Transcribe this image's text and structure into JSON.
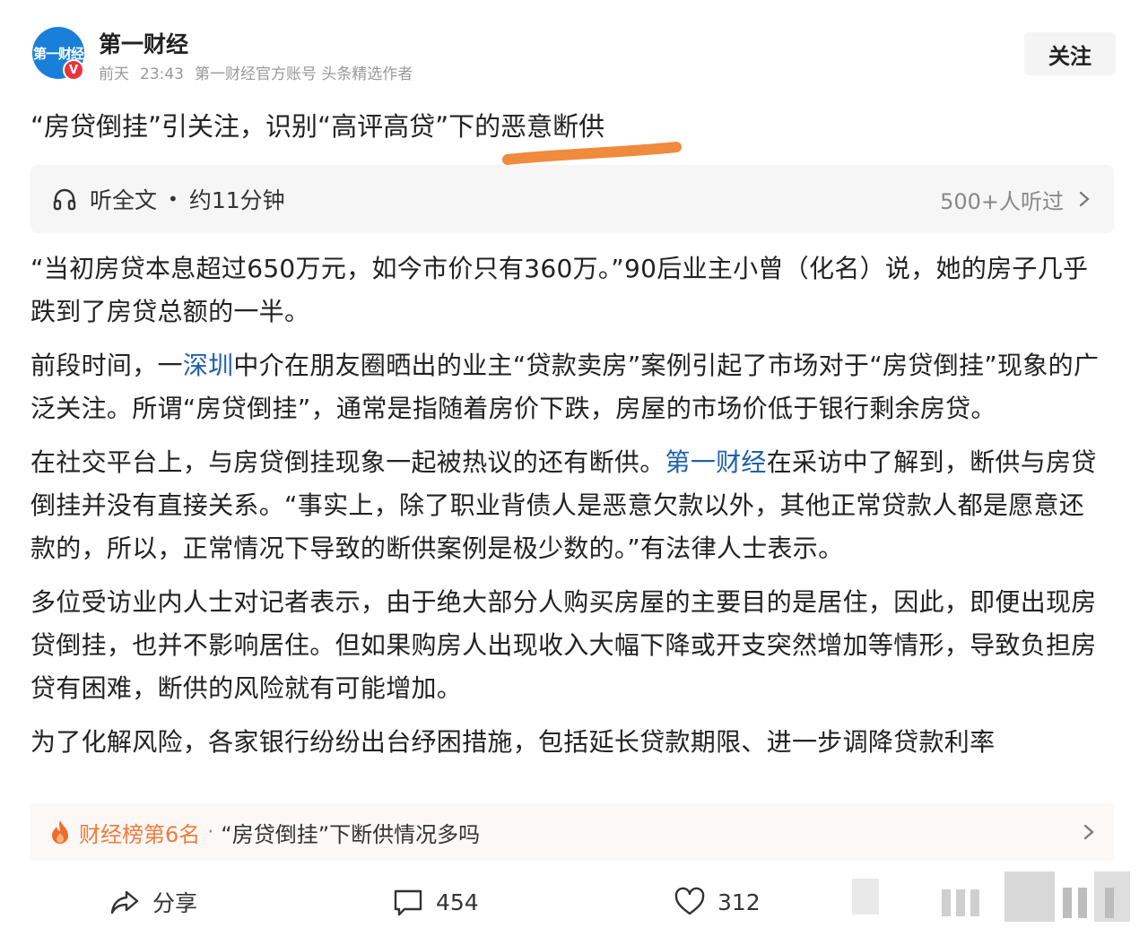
{
  "header": {
    "avatar_text": "第一财经",
    "verified_badge": "V",
    "author_name": "第一财经",
    "time_day": "前天",
    "time_clock": "23:43",
    "account_desc": "第一财经官方账号 头条精选作者",
    "follow_label": "关注"
  },
  "article": {
    "title": "“房贷倒挂”引关注，识别“高评高贷”下的恶意断供",
    "listen": {
      "label": "听全文",
      "dot": "•",
      "duration": "约11分钟",
      "count": "500+人听过"
    },
    "paragraphs": [
      {
        "text": "“当初房贷本息超过650万元，如今市价只有360万。”90后业主小曾（化名）说，她的房子几乎跌到了房贷总额的一半。"
      },
      {
        "before": "前段时间，一",
        "link": "深圳",
        "after": "中介在朋友圈晒出的业主“贷款卖房”案例引起了市场对于“房贷倒挂”现象的广泛关注。所谓“房贷倒挂”，通常是指随着房价下跌，房屋的市场价低于银行剩余房贷。"
      },
      {
        "before": "在社交平台上，与房贷倒挂现象一起被热议的还有断供。",
        "link": "第一财经",
        "after": "在采访中了解到，断供与房贷倒挂并没有直接关系。“事实上，除了职业背债人是恶意欠款以外，其他正常贷款人都是愿意还款的，所以，正常情况下导致的断供案例是极少数的。”有法律人士表示。"
      },
      {
        "text": "多位受访业内人士对记者表示，由于绝大部分人购买房屋的主要目的是居住，因此，即便出现房贷倒挂，也并不影响居住。但如果购房人出现收入大幅下降或开支突然增加等情形，导致负担房贷有困难，断供的风险就有可能增加。"
      },
      {
        "text": "为了化解风险，各家银行纷纷出台纾困措施，包括延长贷款期限、进一步调降贷款利率"
      }
    ]
  },
  "hot": {
    "rank": "财经榜第6名",
    "separator": "·",
    "topic": "“房贷倒挂”下断供情况多吗"
  },
  "actions": {
    "share": "分享",
    "comments": "454",
    "likes": "312"
  },
  "colors": {
    "link": "#1f5fae",
    "hot_rank": "#f07c3a",
    "highlight_stroke": "#f08a3c",
    "avatar_bg": "#1a7fd8",
    "verified_bg": "#e8343a"
  }
}
